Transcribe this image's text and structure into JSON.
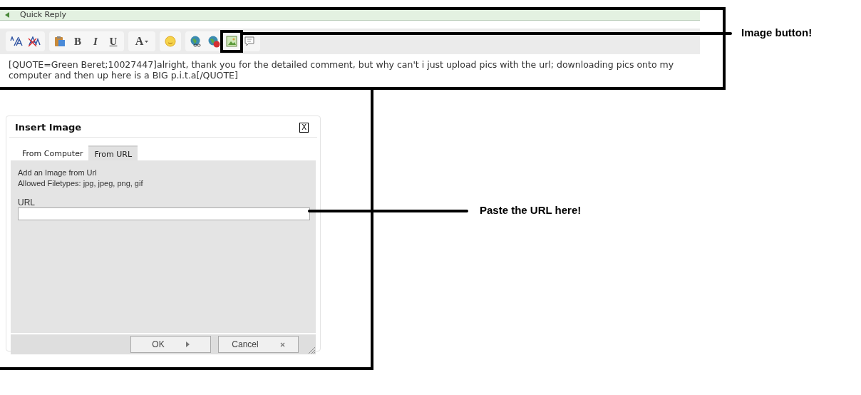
{
  "quick_reply": {
    "title": "Quick Reply"
  },
  "toolbar": {
    "groups": [
      {
        "items": [
          {
            "kind": "font-size",
            "highlighted": false
          },
          {
            "kind": "remove-format",
            "highlighted": false
          }
        ]
      },
      {
        "items": [
          {
            "kind": "paste",
            "highlighted": false
          },
          {
            "kind": "bold",
            "label": "B",
            "highlighted": false
          },
          {
            "kind": "italic",
            "label": "I",
            "highlighted": false
          },
          {
            "kind": "underline",
            "label": "U",
            "highlighted": false
          }
        ]
      },
      {
        "items": [
          {
            "kind": "color",
            "label": "A",
            "highlighted": false
          }
        ]
      },
      {
        "items": [
          {
            "kind": "smiley",
            "highlighted": false
          }
        ]
      },
      {
        "items": [
          {
            "kind": "link",
            "highlighted": false
          },
          {
            "kind": "unlink",
            "highlighted": false
          },
          {
            "kind": "image",
            "highlighted": true
          },
          {
            "kind": "quote",
            "highlighted": false
          }
        ]
      }
    ]
  },
  "editor": {
    "value": "[QUOTE=Green Beret;10027447]alright, thank you for the detailed comment, but why can't i just upload pics with the url; downloading pics onto my computer and then up here is a BIG p.i.t.a[/QUOTE]"
  },
  "dialog": {
    "title": "Insert Image",
    "close": "X",
    "tabs": [
      {
        "label": "From Computer",
        "selected": false
      },
      {
        "label": "From URL",
        "selected": true
      }
    ],
    "lines": [
      "Add an Image from Url",
      "Allowed Filetypes: jpg, jpeg, png, gif"
    ],
    "url_label": "URL",
    "buttons": [
      {
        "label": "OK",
        "kind": "ok"
      },
      {
        "label": "Cancel",
        "kind": "cancel"
      }
    ]
  },
  "annotations": [
    {
      "kind": "toolbar",
      "text": "Image button!"
    },
    {
      "kind": "field",
      "text": "Paste the URL here!"
    }
  ]
}
